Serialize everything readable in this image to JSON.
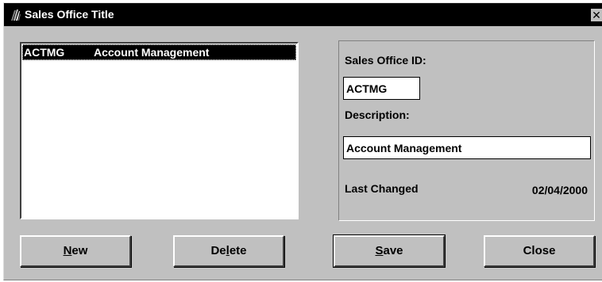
{
  "window": {
    "title": "Sales Office Title",
    "close_glyph": "✕",
    "icon": "book-icon"
  },
  "list": {
    "rows": [
      {
        "id": "ACTMG",
        "description": "Account Management",
        "selected": true
      }
    ]
  },
  "details": {
    "sales_office_id_label": "Sales Office ID:",
    "sales_office_id_value": "ACTMG",
    "description_label": "Description:",
    "description_value": "Account Management",
    "last_changed_label": "Last Changed",
    "last_changed_value": "02/04/2000"
  },
  "buttons": {
    "new": {
      "pre": "",
      "mnemonic": "N",
      "post": "ew"
    },
    "delete": {
      "pre": "De",
      "mnemonic": "l",
      "post": "ete"
    },
    "save": {
      "pre": "",
      "mnemonic": "S",
      "post": "ave"
    },
    "close": {
      "pre": "Close",
      "mnemonic": "",
      "post": ""
    }
  },
  "colors": {
    "face": "#c0c0c0",
    "titlebar": "#000000",
    "selection": "#000000"
  }
}
